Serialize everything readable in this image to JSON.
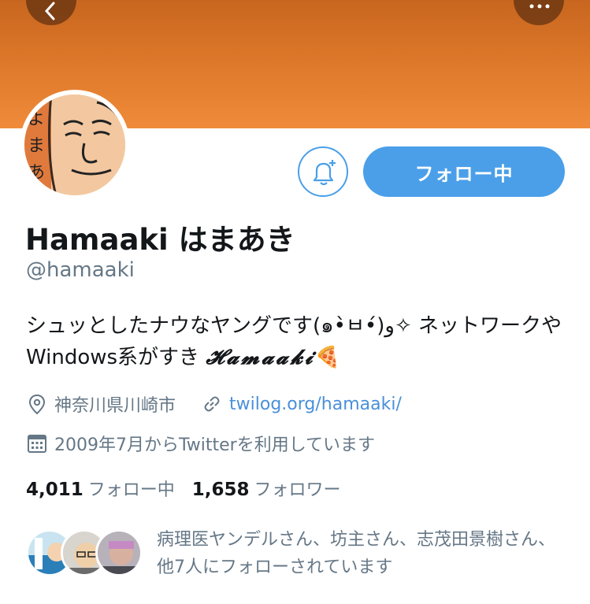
{
  "profile": {
    "display_name": "Hamaaki はまあき",
    "handle": "@hamaaki",
    "bio_text": "シュッとしたナウなヤングです(๑•̀ㅂ•́)و✧ ネットワークやWindows系がすき ",
    "bio_script": "𝓗𝓪𝓶𝓪𝓪𝓴𝓲",
    "bio_emoji": "🍕",
    "location": "神奈川県川崎市",
    "website": "twilog.org/hamaaki/",
    "joined": "2009年7月からTwitterを利用しています",
    "following_count": "4,011",
    "following_label": "フォロー中",
    "followers_count": "1,658",
    "followers_label": "フォロワー",
    "followed_by_text": "病理医ヤンデルさん、坊主さん、志茂田景樹さん、他7人にフォローされています"
  },
  "actions": {
    "follow_button_label": "フォロー中"
  },
  "colors": {
    "banner": "#e07a2c",
    "accent": "#4a9fe8",
    "secondary_text": "#657786"
  },
  "icons": [
    "back-icon",
    "more-icon",
    "notification-bell-icon",
    "location-pin-icon",
    "link-icon",
    "calendar-icon"
  ]
}
